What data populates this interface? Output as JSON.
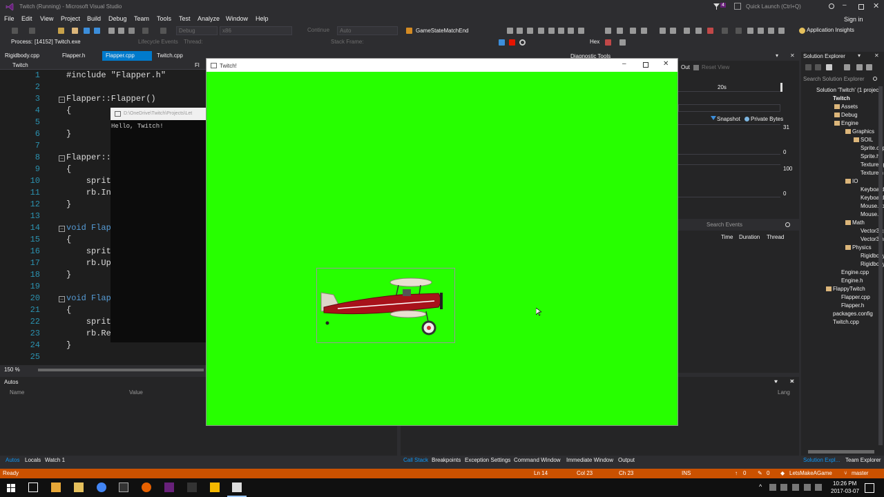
{
  "window": {
    "title": "Twitch (Running) - Microsoft Visual Studio",
    "notification_count": "4",
    "quick_launch_placeholder": "Quick Launch (Ctrl+Q)",
    "sign_in": "Sign in"
  },
  "menu": [
    "File",
    "Edit",
    "View",
    "Project",
    "Build",
    "Debug",
    "Team",
    "Tools",
    "Test",
    "Analyze",
    "Window",
    "Help"
  ],
  "toolbar": {
    "config": "Debug",
    "platform": "x86",
    "continue": "Continue",
    "auto": "Auto",
    "function": "GameStateMatchEnd",
    "hex": "Hex",
    "app_insights": "Application Insights"
  },
  "process_bar": {
    "process_label": "Process:",
    "process_value": "[14152] Twitch.exe",
    "lifecycle": "Lifecycle Events",
    "thread": "Thread:",
    "stack_frame": "Stack Frame:"
  },
  "tabs": [
    {
      "label": "Rigidbody.cpp"
    },
    {
      "label": "Flapper.h"
    },
    {
      "label": "Flapper.cpp"
    },
    {
      "label": "Twitch.cpp"
    }
  ],
  "navbar": {
    "scope": "Twitch",
    "right": "Fl"
  },
  "editor": {
    "lines": [
      {
        "n": "1",
        "code": "#include \"Flapper.h\""
      },
      {
        "n": "2",
        "code": ""
      },
      {
        "n": "3",
        "code": "Flapper::Flapper()"
      },
      {
        "n": "4",
        "code": "{"
      },
      {
        "n": "5",
        "code": ""
      },
      {
        "n": "6",
        "code": "}"
      },
      {
        "n": "7",
        "code": ""
      },
      {
        "n": "8",
        "code": "Flapper::"
      },
      {
        "n": "9",
        "code": "{"
      },
      {
        "n": "10",
        "code": "    sprit"
      },
      {
        "n": "11",
        "code": "    rb.In"
      },
      {
        "n": "12",
        "code": "}"
      },
      {
        "n": "13",
        "code": ""
      },
      {
        "n": "14",
        "code": "void Flap"
      },
      {
        "n": "15",
        "code": "{"
      },
      {
        "n": "16",
        "code": "    sprit"
      },
      {
        "n": "17",
        "code": "    rb.Up"
      },
      {
        "n": "18",
        "code": "}"
      },
      {
        "n": "19",
        "code": ""
      },
      {
        "n": "20",
        "code": "void Flap"
      },
      {
        "n": "21",
        "code": "{"
      },
      {
        "n": "22",
        "code": "    sprit"
      },
      {
        "n": "23",
        "code": "    rb.Re"
      },
      {
        "n": "24",
        "code": "}"
      },
      {
        "n": "25",
        "code": ""
      }
    ],
    "zoom": "150 %"
  },
  "console": {
    "path": "D:\\OneDrive\\Twitch\\Projects\\Let",
    "output": "Hello, Twitch!"
  },
  "game_window": {
    "title": "Twitch!"
  },
  "diag": {
    "title": "Diagnostic Tools",
    "step_out": "Out",
    "reset_view": "Reset View",
    "time_label": "20s",
    "snapshot": "Snapshot",
    "private_bytes": "Private Bytes",
    "mem_max": "31",
    "mem_min": "0",
    "cpu_max": "100",
    "cpu_min": "0",
    "search_events": "Search Events",
    "cols": [
      "Time",
      "Duration",
      "Thread"
    ]
  },
  "autos": {
    "title": "Autos",
    "col_name": "Name",
    "col_value": "Value",
    "col_lang": "Lang",
    "tabs": [
      "Autos",
      "Locals",
      "Watch 1"
    ]
  },
  "bottom_right_tabs": [
    "Call Stack",
    "Breakpoints",
    "Exception Settings",
    "Command Window",
    "Immediate Window",
    "Output"
  ],
  "solution_explorer": {
    "title": "Solution Explorer",
    "search_placeholder": "Search Solution Explorer",
    "items": [
      {
        "label": "Solution 'Twitch' (1 project",
        "indent": 0
      },
      {
        "label": "Twitch",
        "indent": 1
      },
      {
        "label": "Assets",
        "indent": 2
      },
      {
        "label": "Debug",
        "indent": 2
      },
      {
        "label": "Engine",
        "indent": 2
      },
      {
        "label": "Graphics",
        "indent": 3
      },
      {
        "label": "SOIL",
        "indent": 4
      },
      {
        "label": "Sprite.cpp",
        "indent": 4
      },
      {
        "label": "Sprite.h",
        "indent": 4
      },
      {
        "label": "Texture.cpp",
        "indent": 4
      },
      {
        "label": "Texture.h",
        "indent": 4
      },
      {
        "label": "IO",
        "indent": 3
      },
      {
        "label": "Keyboard.cp",
        "indent": 4
      },
      {
        "label": "Keyboard.h",
        "indent": 4
      },
      {
        "label": "Mouse.cpp",
        "indent": 4
      },
      {
        "label": "Mouse.h",
        "indent": 4
      },
      {
        "label": "Math",
        "indent": 3
      },
      {
        "label": "Vector3.cpp",
        "indent": 4
      },
      {
        "label": "Vector3.h",
        "indent": 4
      },
      {
        "label": "Physics",
        "indent": 3
      },
      {
        "label": "Rigidbody.cp",
        "indent": 4
      },
      {
        "label": "Rigidbody.h",
        "indent": 4
      },
      {
        "label": "Engine.cpp",
        "indent": 3
      },
      {
        "label": "Engine.h",
        "indent": 3
      },
      {
        "label": "FlappyTwitch",
        "indent": 2
      },
      {
        "label": "Flapper.cpp",
        "indent": 3
      },
      {
        "label": "Flapper.h",
        "indent": 3
      },
      {
        "label": "packages.config",
        "indent": 2
      },
      {
        "label": "Twitch.cpp",
        "indent": 1
      }
    ],
    "bottom_tabs": [
      "Solution Expl...",
      "Team Explorer"
    ]
  },
  "status": {
    "ready": "Ready",
    "ln": "Ln 14",
    "col": "Col 23",
    "ch": "Ch 23",
    "ins": "INS",
    "up": "0",
    "pencil": "0",
    "repo": "LetsMakeAGame",
    "branch": "master"
  },
  "taskbar": {
    "time": "10:26 PM",
    "date": "2017-03-07"
  },
  "colors": {
    "vs_bg": "#2d2d30",
    "editor_bg": "#1e1e1e",
    "accent": "#007acc",
    "status_debug": "#ca5100",
    "game_bg": "#27ff00"
  }
}
